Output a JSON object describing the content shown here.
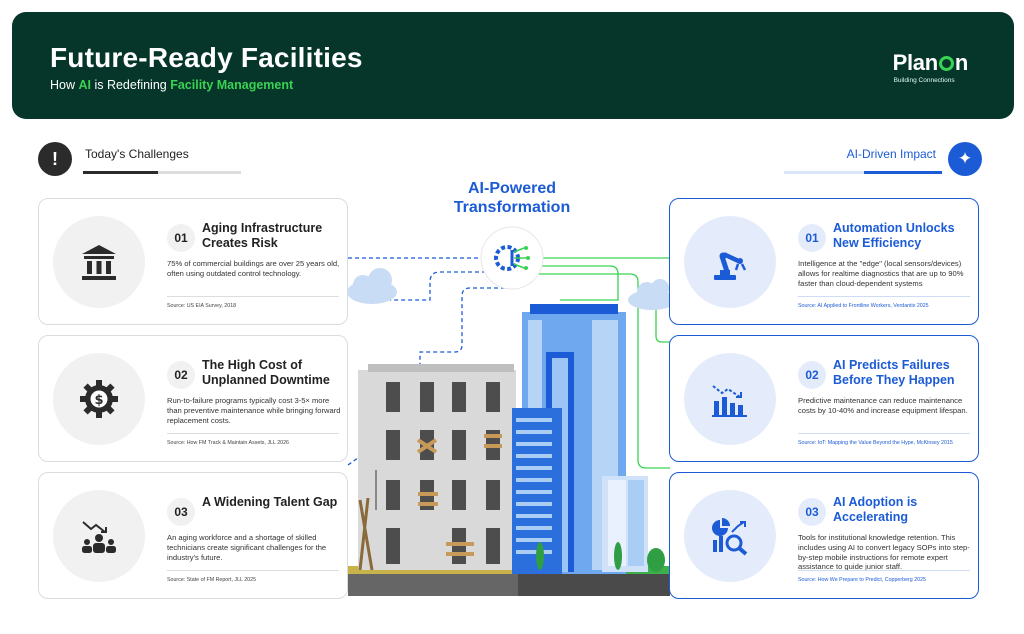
{
  "header": {
    "title": "Future-Ready Facilities",
    "subtitle_pre": "How ",
    "subtitle_ai": "AI",
    "subtitle_mid": " is Redefining ",
    "subtitle_fm": "Facility Management",
    "logo_pre": "Plan",
    "logo_post": "n",
    "logo_tagline": "Building Connections"
  },
  "left_section": {
    "label": "Today's Challenges",
    "icon": "warning-icon"
  },
  "right_section": {
    "label": "AI-Driven Impact",
    "icon": "sparkles-icon"
  },
  "center": {
    "title_line1": "AI-Powered",
    "title_line2": "Transformation",
    "icon": "ai-chip-icon"
  },
  "challenges": [
    {
      "num": "01",
      "title": "Aging Infrastructure Creates Risk",
      "body": "75% of commercial buildings are over 25 years old, often using outdated control technology.",
      "source": "Source: US EIA Survey, 2018",
      "icon": "building-columns-icon"
    },
    {
      "num": "02",
      "title": "The High Cost of Unplanned Downtime",
      "body": "Run-to-failure programs typically cost 3-5× more than preventive maintenance while bringing forward replacement costs.",
      "source": "Source: How FM Track & Maintain Assets, JLL 2026",
      "icon": "gear-dollar-icon"
    },
    {
      "num": "03",
      "title": "A Widening Talent Gap",
      "body": "An aging workforce and a shortage of skilled technicians create significant challenges for the industry's future.",
      "source": "Source: State of FM Report, JLL 2025",
      "icon": "workforce-decline-icon"
    }
  ],
  "impacts": [
    {
      "num": "01",
      "title": "Automation Unlocks New Efficiency",
      "body": "Intelligence at the \"edge\" (local sensors/devices) allows for realtime diagnostics that are up to 90% faster than cloud-dependent systems",
      "source": "Source: AI Applied to Frontline Workers, Verdantix 2025",
      "icon": "robot-arm-icon"
    },
    {
      "num": "02",
      "title": "AI Predicts Failures Before They Happen",
      "body": "Predictive maintenance can reduce maintenance costs by 10-40% and increase equipment lifespan.",
      "source": "Source: IoT: Mapping the Value Beyond the Hype, McKinsey 2015",
      "icon": "declining-chart-icon"
    },
    {
      "num": "03",
      "title": "AI Adoption is Accelerating",
      "body": "Tools for institutional knowledge retention. This includes using AI to convert legacy SOPs into step-by-step mobile instructions for remote expert assistance to guide junior staff.",
      "source": "Source: How We Prepare to Predict, Copperberg 2025",
      "icon": "analytics-magnifier-icon"
    }
  ],
  "colors": {
    "header_bg": "#06352a",
    "accent_green": "#39d353",
    "accent_blue": "#1c5bd6",
    "dark": "#2b2b2b"
  }
}
